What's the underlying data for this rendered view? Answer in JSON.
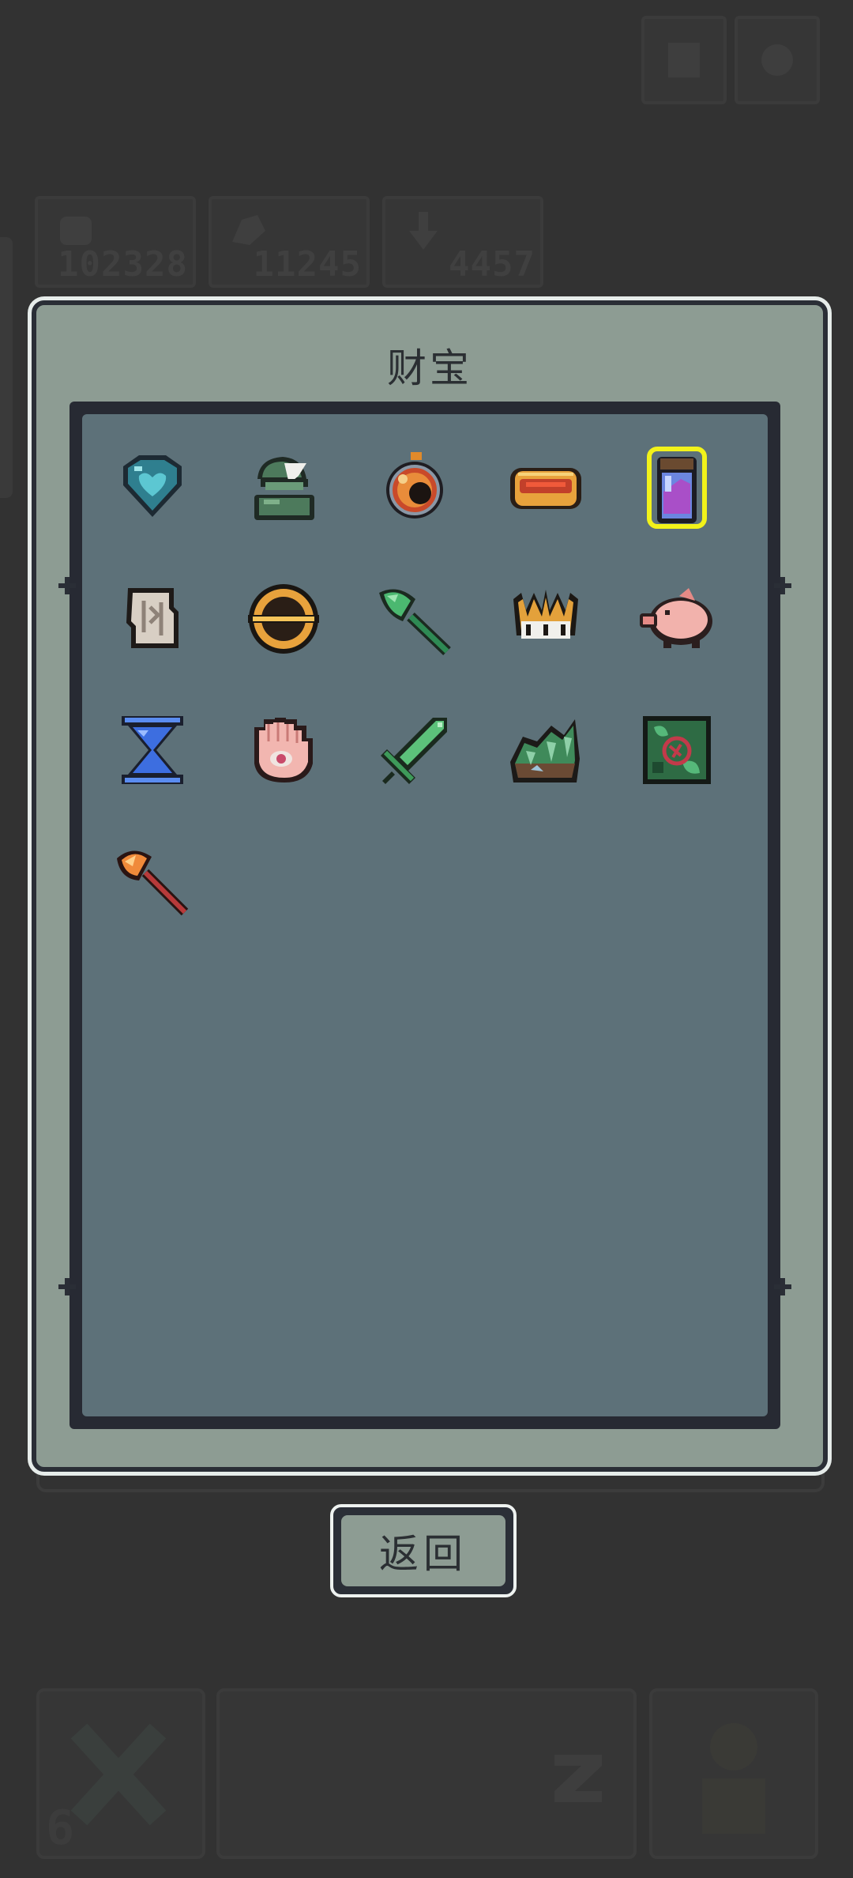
{
  "hud": {
    "resources": [
      {
        "icon": "fist-icon",
        "value": "102328"
      },
      {
        "icon": "flex-arm-icon",
        "value": "11245"
      },
      {
        "icon": "arrow-down-icon",
        "value": "4457"
      }
    ],
    "top_buttons": [
      "map-icon",
      "settings-icon"
    ],
    "bottom_counter": "6"
  },
  "dialog": {
    "title": "财宝",
    "back_label": "返回",
    "items": [
      {
        "name": "blue-heart-gem-icon",
        "selected": false
      },
      {
        "name": "green-helmet-icon",
        "selected": false
      },
      {
        "name": "eye-orb-icon",
        "selected": false
      },
      {
        "name": "gold-ring-icon",
        "selected": false
      },
      {
        "name": "potion-jar-icon",
        "selected": true
      },
      {
        "name": "ancient-scroll-icon",
        "selected": false
      },
      {
        "name": "golden-disc-icon",
        "selected": false
      },
      {
        "name": "green-axe-icon",
        "selected": false
      },
      {
        "name": "golden-crown-icon",
        "selected": false
      },
      {
        "name": "pink-pig-icon",
        "selected": false
      },
      {
        "name": "blue-hourglass-icon",
        "selected": false
      },
      {
        "name": "eye-hand-icon",
        "selected": false
      },
      {
        "name": "green-sword-icon",
        "selected": false
      },
      {
        "name": "crystal-rock-icon",
        "selected": false
      },
      {
        "name": "green-rune-book-icon",
        "selected": false
      },
      {
        "name": "fire-axe-icon",
        "selected": false
      }
    ]
  },
  "colors": {
    "background": "#323232",
    "dialog_frame": "#8d9c93",
    "grid_bg": "#5d7179",
    "selection": "#f2f21a"
  }
}
